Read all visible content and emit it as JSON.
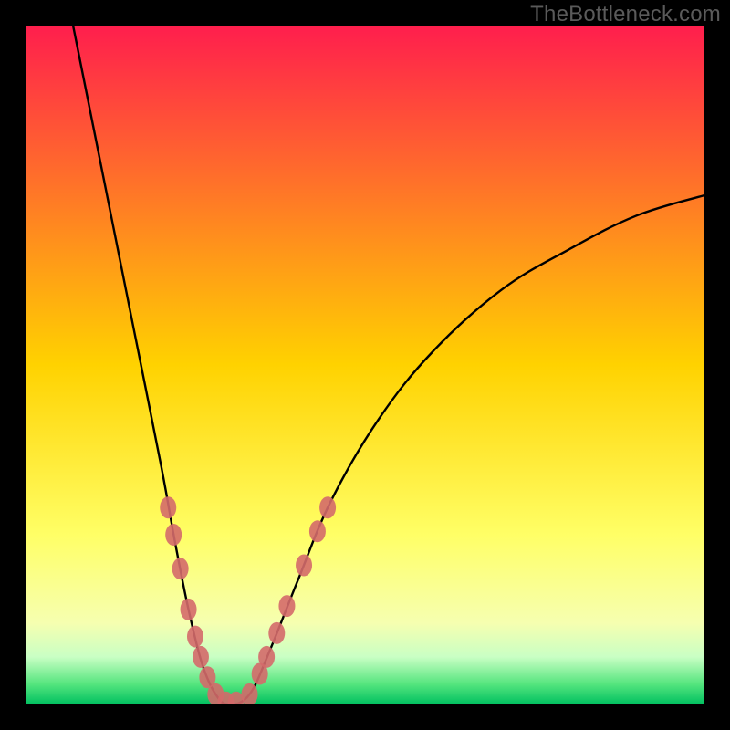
{
  "watermark": "TheBottleneck.com",
  "chart_data": {
    "type": "line",
    "title": "",
    "xlabel": "",
    "ylabel": "",
    "x_range": [
      0,
      100
    ],
    "y_range": [
      0,
      100
    ],
    "background_gradient": {
      "stops": [
        {
          "offset": 0.0,
          "color": "#ff1e4d"
        },
        {
          "offset": 0.5,
          "color": "#ffd200"
        },
        {
          "offset": 0.75,
          "color": "#ffff66"
        },
        {
          "offset": 0.88,
          "color": "#f6ffb0"
        },
        {
          "offset": 0.93,
          "color": "#c9ffc4"
        },
        {
          "offset": 0.97,
          "color": "#55e57e"
        },
        {
          "offset": 1.0,
          "color": "#00c060"
        }
      ]
    },
    "series": [
      {
        "name": "bottleneck-curve",
        "type": "line",
        "color": "#000000",
        "points": [
          {
            "x": 7.0,
            "y": 100.0
          },
          {
            "x": 10.0,
            "y": 85.0
          },
          {
            "x": 13.0,
            "y": 70.0
          },
          {
            "x": 16.0,
            "y": 55.0
          },
          {
            "x": 20.0,
            "y": 35.0
          },
          {
            "x": 22.0,
            "y": 24.0
          },
          {
            "x": 24.0,
            "y": 14.0
          },
          {
            "x": 26.0,
            "y": 6.0
          },
          {
            "x": 28.0,
            "y": 1.5
          },
          {
            "x": 30.0,
            "y": 0.0
          },
          {
            "x": 33.0,
            "y": 1.5
          },
          {
            "x": 36.0,
            "y": 8.0
          },
          {
            "x": 40.0,
            "y": 18.0
          },
          {
            "x": 45.0,
            "y": 30.0
          },
          {
            "x": 52.0,
            "y": 42.0
          },
          {
            "x": 60.0,
            "y": 52.0
          },
          {
            "x": 70.0,
            "y": 61.0
          },
          {
            "x": 80.0,
            "y": 67.0
          },
          {
            "x": 90.0,
            "y": 72.0
          },
          {
            "x": 100.0,
            "y": 75.0
          }
        ]
      },
      {
        "name": "left-branch-markers",
        "type": "scatter",
        "color": "#d46a6a",
        "points": [
          {
            "x": 21.0,
            "y": 29.0
          },
          {
            "x": 21.8,
            "y": 25.0
          },
          {
            "x": 22.8,
            "y": 20.0
          },
          {
            "x": 24.0,
            "y": 14.0
          },
          {
            "x": 25.0,
            "y": 10.0
          },
          {
            "x": 25.8,
            "y": 7.0
          },
          {
            "x": 26.8,
            "y": 4.0
          },
          {
            "x": 28.0,
            "y": 1.5
          },
          {
            "x": 29.5,
            "y": 0.3
          },
          {
            "x": 31.0,
            "y": 0.3
          }
        ]
      },
      {
        "name": "right-branch-markers",
        "type": "scatter",
        "color": "#d46a6a",
        "points": [
          {
            "x": 33.0,
            "y": 1.5
          },
          {
            "x": 34.5,
            "y": 4.5
          },
          {
            "x": 35.5,
            "y": 7.0
          },
          {
            "x": 37.0,
            "y": 10.5
          },
          {
            "x": 38.5,
            "y": 14.5
          },
          {
            "x": 41.0,
            "y": 20.5
          },
          {
            "x": 43.0,
            "y": 25.5
          },
          {
            "x": 44.5,
            "y": 29.0
          }
        ]
      }
    ]
  }
}
